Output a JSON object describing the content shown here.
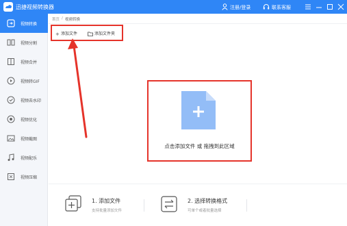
{
  "titlebar": {
    "app_title": "迅捷视频转换器",
    "login": "注册/登录",
    "service": "联系客服",
    "window_buttons": [
      "menu",
      "minimize",
      "maximize",
      "close"
    ]
  },
  "colors": {
    "accent": "#2f86f6",
    "highlight_box": "#e5332a",
    "file_icon": "#93bdf7"
  },
  "sidebar": {
    "items": [
      {
        "label": "视频转换",
        "icon": "convert-icon",
        "active": true
      },
      {
        "label": "视频分割",
        "icon": "split-icon",
        "active": false
      },
      {
        "label": "视频合并",
        "icon": "merge-icon",
        "active": false
      },
      {
        "label": "视频转GIF",
        "icon": "gif-icon",
        "active": false
      },
      {
        "label": "视频去水印",
        "icon": "watermark-icon",
        "active": false
      },
      {
        "label": "视频优化",
        "icon": "optimize-icon",
        "active": false
      },
      {
        "label": "视频截图",
        "icon": "screenshot-icon",
        "active": false
      },
      {
        "label": "视频配乐",
        "icon": "music-icon",
        "active": false
      },
      {
        "label": "视频压缩",
        "icon": "compress-icon",
        "active": false
      }
    ]
  },
  "breadcrumb": {
    "home": "首页",
    "separator": "/",
    "current": "视频转换"
  },
  "toolbar": {
    "add_file": "添加文件",
    "add_folder": "添加文件夹"
  },
  "dropzone": {
    "text": "点击添加文件 或 拖拽到此区域"
  },
  "steps": [
    {
      "title": "1. 添加文件",
      "desc": "支持批量添加文件",
      "icon": "add-file-icon"
    },
    {
      "title": "2. 选择转换格式",
      "desc": "可单个或者批量选择",
      "icon": "convert-format-icon"
    }
  ]
}
